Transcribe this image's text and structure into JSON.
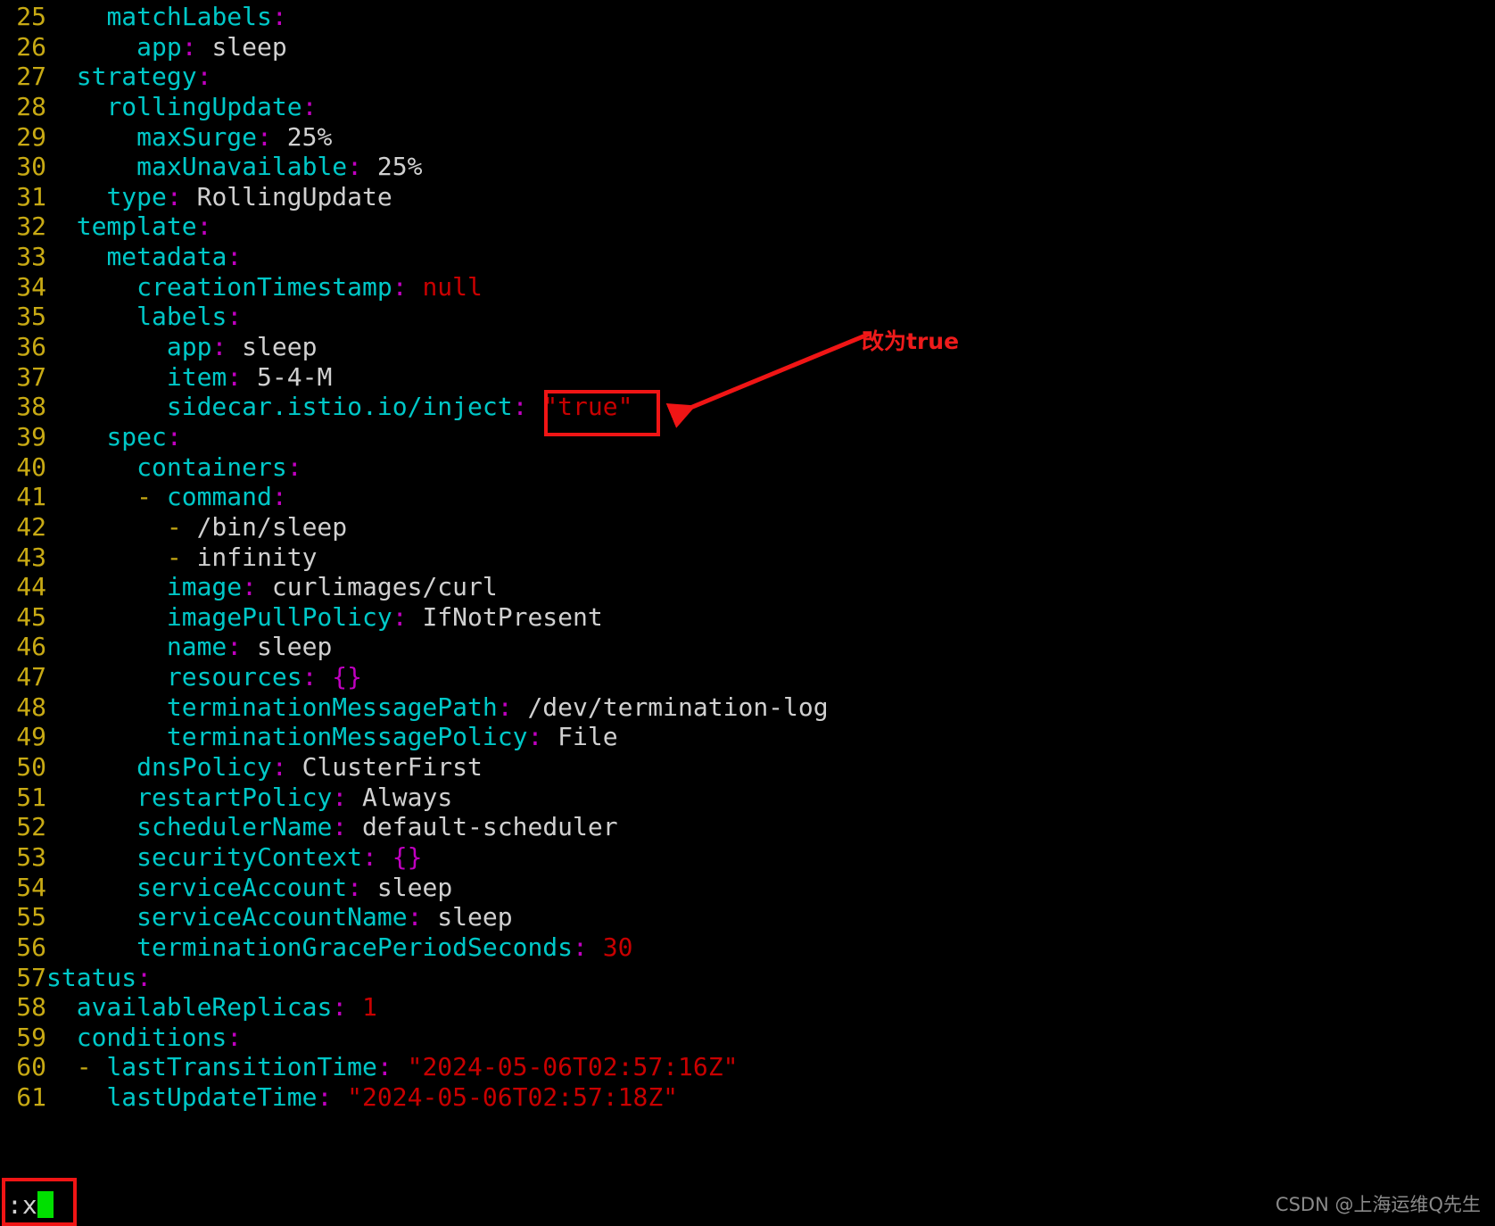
{
  "editor": {
    "kind": "vim-yaml-buffer",
    "colors": {
      "background": "#000000",
      "line_number": "#c8aa14",
      "key": "#00c8c8",
      "punctuation": "#c000c0",
      "value": "#d0d0d0",
      "string": "#c80000",
      "dash": "#c8aa14",
      "annotation": "#ee1b1b",
      "cursor": "#00e000"
    },
    "lines": [
      {
        "num": "25",
        "tokens": [
          {
            "t": "    ",
            "c": "v"
          },
          {
            "t": "matchLabels",
            "c": "k"
          },
          {
            "t": ":",
            "c": "p"
          }
        ]
      },
      {
        "num": "26",
        "tokens": [
          {
            "t": "      ",
            "c": "v"
          },
          {
            "t": "app",
            "c": "k"
          },
          {
            "t": ":",
            "c": "p"
          },
          {
            "t": " sleep",
            "c": "v"
          }
        ]
      },
      {
        "num": "27",
        "tokens": [
          {
            "t": "  ",
            "c": "v"
          },
          {
            "t": "strategy",
            "c": "k"
          },
          {
            "t": ":",
            "c": "p"
          }
        ]
      },
      {
        "num": "28",
        "tokens": [
          {
            "t": "    ",
            "c": "v"
          },
          {
            "t": "rollingUpdate",
            "c": "k"
          },
          {
            "t": ":",
            "c": "p"
          }
        ]
      },
      {
        "num": "29",
        "tokens": [
          {
            "t": "      ",
            "c": "v"
          },
          {
            "t": "maxSurge",
            "c": "k"
          },
          {
            "t": ":",
            "c": "p"
          },
          {
            "t": " 25%",
            "c": "v"
          }
        ]
      },
      {
        "num": "30",
        "tokens": [
          {
            "t": "      ",
            "c": "v"
          },
          {
            "t": "maxUnavailable",
            "c": "k"
          },
          {
            "t": ":",
            "c": "p"
          },
          {
            "t": " 25%",
            "c": "v"
          }
        ]
      },
      {
        "num": "31",
        "tokens": [
          {
            "t": "    ",
            "c": "v"
          },
          {
            "t": "type",
            "c": "k"
          },
          {
            "t": ":",
            "c": "p"
          },
          {
            "t": " RollingUpdate",
            "c": "v"
          }
        ]
      },
      {
        "num": "32",
        "tokens": [
          {
            "t": "  ",
            "c": "v"
          },
          {
            "t": "template",
            "c": "k"
          },
          {
            "t": ":",
            "c": "p"
          }
        ]
      },
      {
        "num": "33",
        "tokens": [
          {
            "t": "    ",
            "c": "v"
          },
          {
            "t": "metadata",
            "c": "k"
          },
          {
            "t": ":",
            "c": "p"
          }
        ]
      },
      {
        "num": "34",
        "tokens": [
          {
            "t": "      ",
            "c": "v"
          },
          {
            "t": "creationTimestamp",
            "c": "k"
          },
          {
            "t": ":",
            "c": "p"
          },
          {
            "t": " ",
            "c": "v"
          },
          {
            "t": "null",
            "c": "s"
          }
        ]
      },
      {
        "num": "35",
        "tokens": [
          {
            "t": "      ",
            "c": "v"
          },
          {
            "t": "labels",
            "c": "k"
          },
          {
            "t": ":",
            "c": "p"
          }
        ]
      },
      {
        "num": "36",
        "tokens": [
          {
            "t": "        ",
            "c": "v"
          },
          {
            "t": "app",
            "c": "k"
          },
          {
            "t": ":",
            "c": "p"
          },
          {
            "t": " sleep",
            "c": "v"
          }
        ]
      },
      {
        "num": "37",
        "tokens": [
          {
            "t": "        ",
            "c": "v"
          },
          {
            "t": "item",
            "c": "k"
          },
          {
            "t": ":",
            "c": "p"
          },
          {
            "t": " 5-4-M",
            "c": "v"
          }
        ]
      },
      {
        "num": "38",
        "tokens": [
          {
            "t": "        ",
            "c": "v"
          },
          {
            "t": "sidecar.istio.io/inject",
            "c": "k"
          },
          {
            "t": ":",
            "c": "p"
          },
          {
            "t": " ",
            "c": "v"
          },
          {
            "t": "\"true\"",
            "c": "s"
          }
        ]
      },
      {
        "num": "39",
        "tokens": [
          {
            "t": "    ",
            "c": "v"
          },
          {
            "t": "spec",
            "c": "k"
          },
          {
            "t": ":",
            "c": "p"
          }
        ]
      },
      {
        "num": "40",
        "tokens": [
          {
            "t": "      ",
            "c": "v"
          },
          {
            "t": "containers",
            "c": "k"
          },
          {
            "t": ":",
            "c": "p"
          }
        ]
      },
      {
        "num": "41",
        "tokens": [
          {
            "t": "      ",
            "c": "v"
          },
          {
            "t": "-",
            "c": "d"
          },
          {
            "t": " ",
            "c": "v"
          },
          {
            "t": "command",
            "c": "k"
          },
          {
            "t": ":",
            "c": "p"
          }
        ]
      },
      {
        "num": "42",
        "tokens": [
          {
            "t": "        ",
            "c": "v"
          },
          {
            "t": "-",
            "c": "d"
          },
          {
            "t": " /bin/sleep",
            "c": "v"
          }
        ]
      },
      {
        "num": "43",
        "tokens": [
          {
            "t": "        ",
            "c": "v"
          },
          {
            "t": "-",
            "c": "d"
          },
          {
            "t": " infinity",
            "c": "v"
          }
        ]
      },
      {
        "num": "44",
        "tokens": [
          {
            "t": "        ",
            "c": "v"
          },
          {
            "t": "image",
            "c": "k"
          },
          {
            "t": ":",
            "c": "p"
          },
          {
            "t": " curlimages/curl",
            "c": "v"
          }
        ]
      },
      {
        "num": "45",
        "tokens": [
          {
            "t": "        ",
            "c": "v"
          },
          {
            "t": "imagePullPolicy",
            "c": "k"
          },
          {
            "t": ":",
            "c": "p"
          },
          {
            "t": " IfNotPresent",
            "c": "v"
          }
        ]
      },
      {
        "num": "46",
        "tokens": [
          {
            "t": "        ",
            "c": "v"
          },
          {
            "t": "name",
            "c": "k"
          },
          {
            "t": ":",
            "c": "p"
          },
          {
            "t": " sleep",
            "c": "v"
          }
        ]
      },
      {
        "num": "47",
        "tokens": [
          {
            "t": "        ",
            "c": "v"
          },
          {
            "t": "resources",
            "c": "k"
          },
          {
            "t": ":",
            "c": "p"
          },
          {
            "t": " ",
            "c": "v"
          },
          {
            "t": "{}",
            "c": "p"
          }
        ]
      },
      {
        "num": "48",
        "tokens": [
          {
            "t": "        ",
            "c": "v"
          },
          {
            "t": "terminationMessagePath",
            "c": "k"
          },
          {
            "t": ":",
            "c": "p"
          },
          {
            "t": " /dev/termination-log",
            "c": "v"
          }
        ]
      },
      {
        "num": "49",
        "tokens": [
          {
            "t": "        ",
            "c": "v"
          },
          {
            "t": "terminationMessagePolicy",
            "c": "k"
          },
          {
            "t": ":",
            "c": "p"
          },
          {
            "t": " File",
            "c": "v"
          }
        ]
      },
      {
        "num": "50",
        "tokens": [
          {
            "t": "      ",
            "c": "v"
          },
          {
            "t": "dnsPolicy",
            "c": "k"
          },
          {
            "t": ":",
            "c": "p"
          },
          {
            "t": " ClusterFirst",
            "c": "v"
          }
        ]
      },
      {
        "num": "51",
        "tokens": [
          {
            "t": "      ",
            "c": "v"
          },
          {
            "t": "restartPolicy",
            "c": "k"
          },
          {
            "t": ":",
            "c": "p"
          },
          {
            "t": " Always",
            "c": "v"
          }
        ]
      },
      {
        "num": "52",
        "tokens": [
          {
            "t": "      ",
            "c": "v"
          },
          {
            "t": "schedulerName",
            "c": "k"
          },
          {
            "t": ":",
            "c": "p"
          },
          {
            "t": " default-scheduler",
            "c": "v"
          }
        ]
      },
      {
        "num": "53",
        "tokens": [
          {
            "t": "      ",
            "c": "v"
          },
          {
            "t": "securityContext",
            "c": "k"
          },
          {
            "t": ":",
            "c": "p"
          },
          {
            "t": " ",
            "c": "v"
          },
          {
            "t": "{}",
            "c": "p"
          }
        ]
      },
      {
        "num": "54",
        "tokens": [
          {
            "t": "      ",
            "c": "v"
          },
          {
            "t": "serviceAccount",
            "c": "k"
          },
          {
            "t": ":",
            "c": "p"
          },
          {
            "t": " sleep",
            "c": "v"
          }
        ]
      },
      {
        "num": "55",
        "tokens": [
          {
            "t": "      ",
            "c": "v"
          },
          {
            "t": "serviceAccountName",
            "c": "k"
          },
          {
            "t": ":",
            "c": "p"
          },
          {
            "t": " sleep",
            "c": "v"
          }
        ]
      },
      {
        "num": "56",
        "tokens": [
          {
            "t": "      ",
            "c": "v"
          },
          {
            "t": "terminationGracePeriodSeconds",
            "c": "k"
          },
          {
            "t": ":",
            "c": "p"
          },
          {
            "t": " ",
            "c": "v"
          },
          {
            "t": "30",
            "c": "s"
          }
        ]
      },
      {
        "num": "57",
        "tokens": [
          {
            "t": "",
            "c": "v"
          },
          {
            "t": "status",
            "c": "k"
          },
          {
            "t": ":",
            "c": "p"
          }
        ]
      },
      {
        "num": "58",
        "tokens": [
          {
            "t": "  ",
            "c": "v"
          },
          {
            "t": "availableReplicas",
            "c": "k"
          },
          {
            "t": ":",
            "c": "p"
          },
          {
            "t": " ",
            "c": "v"
          },
          {
            "t": "1",
            "c": "s"
          }
        ]
      },
      {
        "num": "59",
        "tokens": [
          {
            "t": "  ",
            "c": "v"
          },
          {
            "t": "conditions",
            "c": "k"
          },
          {
            "t": ":",
            "c": "p"
          }
        ]
      },
      {
        "num": "60",
        "tokens": [
          {
            "t": "  ",
            "c": "v"
          },
          {
            "t": "-",
            "c": "d"
          },
          {
            "t": " ",
            "c": "v"
          },
          {
            "t": "lastTransitionTime",
            "c": "k"
          },
          {
            "t": ":",
            "c": "p"
          },
          {
            "t": " ",
            "c": "v"
          },
          {
            "t": "\"2024-05-06T02:57:16Z\"",
            "c": "s"
          }
        ]
      },
      {
        "num": "61",
        "tokens": [
          {
            "t": "    ",
            "c": "v"
          },
          {
            "t": "lastUpdateTime",
            "c": "k"
          },
          {
            "t": ":",
            "c": "p"
          },
          {
            "t": " ",
            "c": "v"
          },
          {
            "t": "\"2024-05-06T02:57:18Z\"",
            "c": "s"
          }
        ]
      }
    ]
  },
  "command_line": {
    "text": ":x",
    "cursor_visible": true
  },
  "annotations": {
    "change_to_true_label": "改为true",
    "arrow_from": "改为true label",
    "arrow_to": "\"true\" value on line 38",
    "boxed_value": "\"true\"",
    "boxed_command": ":x"
  },
  "watermark": {
    "text": "CSDN @上海运维Q先生"
  }
}
